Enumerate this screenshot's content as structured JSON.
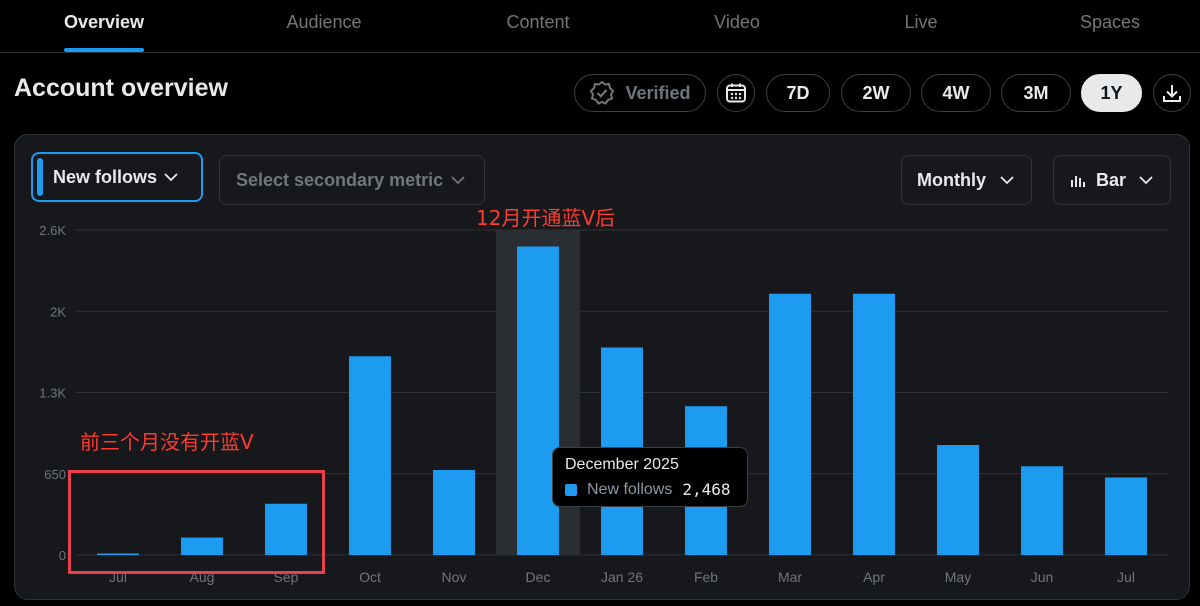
{
  "tabs": [
    {
      "label": "Overview",
      "active": true
    },
    {
      "label": "Audience",
      "active": false
    },
    {
      "label": "Content",
      "active": false
    },
    {
      "label": "Video",
      "active": false
    },
    {
      "label": "Live",
      "active": false
    },
    {
      "label": "Spaces",
      "active": false
    }
  ],
  "page_title": "Account overview",
  "toolbar": {
    "verified_label": "Verified",
    "calendar_icon": "calendar-icon",
    "ranges": [
      "7D",
      "2W",
      "4W",
      "3M",
      "1Y"
    ],
    "selected_range": "1Y",
    "download_icon": "download-icon"
  },
  "controls": {
    "primary_metric": "New follows",
    "secondary_metric_placeholder": "Select secondary metric",
    "interval": "Monthly",
    "chart_type_label": "Bar"
  },
  "annotations": {
    "top_note": "12月开通蓝V后",
    "left_note": "前三个月没有开蓝V"
  },
  "tooltip": {
    "title": "December 2025",
    "metric": "New follows",
    "value": "2,468"
  },
  "colors": {
    "accent": "#1d9bf0",
    "annotation": "#ff3b30",
    "background": "#000000",
    "panel": "#16181c"
  },
  "chart_data": {
    "type": "bar",
    "categories": [
      "Jul",
      "Aug",
      "Sep",
      "Oct",
      "Nov",
      "Dec",
      "Jan 26",
      "Feb",
      "Mar",
      "Apr",
      "May",
      "Jun",
      "Jul"
    ],
    "series": [
      {
        "name": "New follows",
        "values": [
          12,
          140,
          410,
          1590,
          680,
          2468,
          1660,
          1190,
          2090,
          2090,
          880,
          710,
          620
        ]
      }
    ],
    "y_ticks": [
      0,
      650,
      1300,
      1950,
      2600
    ],
    "y_tick_labels": [
      "0",
      "650",
      "1.3K",
      "2K",
      "2.6K"
    ],
    "ylim": [
      0,
      2600
    ],
    "highlighted_category": "Dec",
    "grid": true
  }
}
